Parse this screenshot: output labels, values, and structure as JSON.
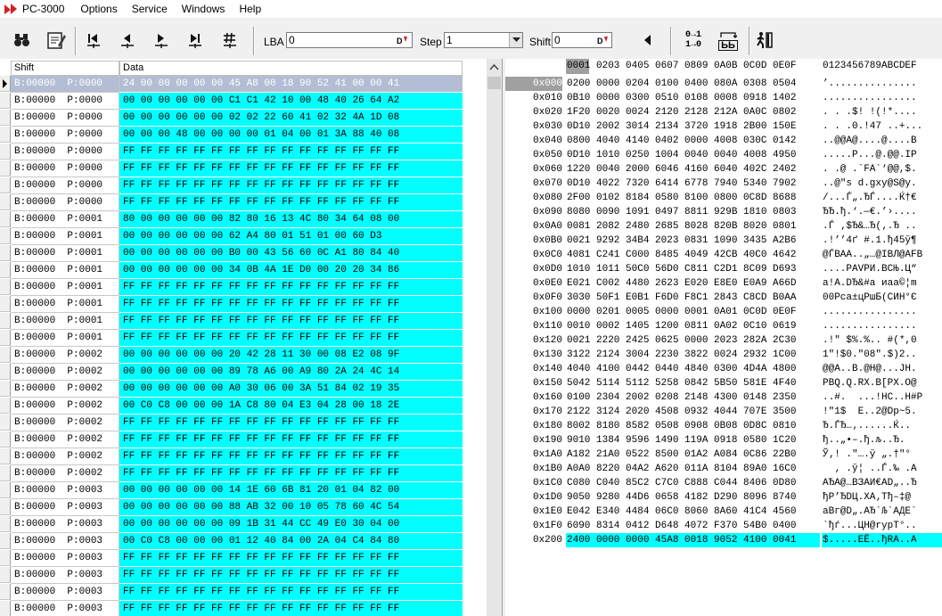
{
  "app": {
    "title": "PC-3000"
  },
  "menu": [
    "Options",
    "Service",
    "Windows",
    "Help"
  ],
  "toolbar": {
    "lba_label": "LBA",
    "lba_value": "0",
    "step_label": "Step",
    "step_value": "1",
    "shift_label": "Shift",
    "shift_value": "0",
    "convert_label_top": "0→1",
    "convert_label_bottom": "1→0",
    "swap_label": "ЬЬ"
  },
  "sectors": {
    "columns": [
      "Shift",
      "Data"
    ],
    "rows": [
      {
        "shift": "B:00000  P:0000",
        "data": "24 00 00 00 00 00 45 A8 00 18 90 52 41 00 00 41"
      },
      {
        "shift": "B:00000  P:0000",
        "data": "00 00 00 00 00 00 C1 C1 42 10 00 48 40 26 64 A2"
      },
      {
        "shift": "B:00000  P:0000",
        "data": "00 00 00 00 00 00 02 02 22 60 41 02 32 4A 1D 08"
      },
      {
        "shift": "B:00000  P:0000",
        "data": "00 00 00 48 00 00 00 00 01 04 00 01 3A 88 40 08"
      },
      {
        "shift": "B:00000  P:0000",
        "data": "FF FF FF FF FF FF FF FF FF FF FF FF FF FF FF FF"
      },
      {
        "shift": "B:00000  P:0000",
        "data": "FF FF FF FF FF FF FF FF FF FF FF FF FF FF FF FF"
      },
      {
        "shift": "B:00000  P:0000",
        "data": "FF FF FF FF FF FF FF FF FF FF FF FF FF FF FF FF"
      },
      {
        "shift": "B:00000  P:0000",
        "data": "FF FF FF FF FF FF FF FF FF FF FF FF FF FF FF FF"
      },
      {
        "shift": "B:00000  P:0001",
        "data": "80 00 00 00 00 00 82 80 16 13 4C 80 34 64 08 00"
      },
      {
        "shift": "B:00000  P:0001",
        "data": "00 00 00 00 00 00 62 A4 80 01 51 01 00 60 D3"
      },
      {
        "shift": "B:00000  P:0001",
        "data": "00 00 00 00 00 00 B0 00 43 56 60 0C A1 80 84 40"
      },
      {
        "shift": "B:00000  P:0001",
        "data": "00 00 00 00 00 00 34 0B 4A 1E D0 00 20 20 34 86"
      },
      {
        "shift": "B:00000  P:0001",
        "data": "FF FF FF FF FF FF FF FF FF FF FF FF FF FF FF FF"
      },
      {
        "shift": "B:00000  P:0001",
        "data": "FF FF FF FF FF FF FF FF FF FF FF FF FF FF FF FF"
      },
      {
        "shift": "B:00000  P:0001",
        "data": "FF FF FF FF FF FF FF FF FF FF FF FF FF FF FF FF"
      },
      {
        "shift": "B:00000  P:0001",
        "data": "FF FF FF FF FF FF FF FF FF FF FF FF FF FF FF FF"
      },
      {
        "shift": "B:00000  P:0002",
        "data": "00 00 00 00 00 00 20 42 28 11 30 00 08 E2 08 9F"
      },
      {
        "shift": "B:00000  P:0002",
        "data": "00 00 00 00 00 00 89 78 A6 00 A9 80 2A 24 4C 14"
      },
      {
        "shift": "B:00000  P:0002",
        "data": "00 00 00 00 00 00 A0 30 06 00 3A 51 84 02 19 35"
      },
      {
        "shift": "B:00000  P:0002",
        "data": "00 C0 C8 00 00 00 1A C8 80 04 E3 04 28 00 18 2E"
      },
      {
        "shift": "B:00000  P:0002",
        "data": "FF FF FF FF FF FF FF FF FF FF FF FF FF FF FF FF"
      },
      {
        "shift": "B:00000  P:0002",
        "data": "FF FF FF FF FF FF FF FF FF FF FF FF FF FF FF FF"
      },
      {
        "shift": "B:00000  P:0002",
        "data": "FF FF FF FF FF FF FF FF FF FF FF FF FF FF FF FF"
      },
      {
        "shift": "B:00000  P:0002",
        "data": "FF FF FF FF FF FF FF FF FF FF FF FF FF FF FF FF"
      },
      {
        "shift": "B:00000  P:0003",
        "data": "00 00 00 00 00 00 14 1E 60 6B 81 20 01 04 82 00"
      },
      {
        "shift": "B:00000  P:0003",
        "data": "00 00 00 00 00 00 88 AB 32 00 10 05 78 60 4C 54"
      },
      {
        "shift": "B:00000  P:0003",
        "data": "00 00 00 00 00 00 09 1B 31 44 CC 49 E0 30 04 00"
      },
      {
        "shift": "B:00000  P:0003",
        "data": "00 C0 C8 00 00 00 01 12 40 84 00 2A 04 C4 84 80"
      },
      {
        "shift": "B:00000  P:0003",
        "data": "FF FF FF FF FF FF FF FF FF FF FF FF FF FF FF FF"
      },
      {
        "shift": "B:00000  P:0003",
        "data": "FF FF FF FF FF FF FF FF FF FF FF FF FF FF FF FF"
      },
      {
        "shift": "B:00000  P:0003",
        "data": "FF FF FF FF FF FF FF FF FF FF FF FF FF FF FF FF"
      },
      {
        "shift": "B:00000  P:0003",
        "data": "FF FF FF FF FF FF FF FF FF FF FF FF FF FF FF FF"
      }
    ]
  },
  "hex": {
    "header_hex": "0001 0203 0405 0607 0809 0A0B 0C0D 0E0F",
    "header_ascii": "0123456789ABCDEF",
    "rows": [
      {
        "off": "0x000",
        "hex": "0200 0000 0204 0100 0400 080A 0308 0504",
        "asc": "’..............."
      },
      {
        "off": "0x010",
        "hex": "0B10 0000 0300 0510 0108 0008 0918 1402",
        "asc": "................"
      },
      {
        "off": "0x020",
        "hex": "1F20 0020 0024 2120 2128 212A 0A0C 0802",
        "asc": ". . .$! !(!*...."
      },
      {
        "off": "0x030",
        "hex": "0D10 2002 3014 2134 3720 1918 2B00 150E",
        "asc": ". . .0.!47 ..+..."
      },
      {
        "off": "0x040",
        "hex": "0800 4040 4140 0402 0000 4008 030C 0142",
        "asc": "..@@A@....@....B"
      },
      {
        "off": "0x050",
        "hex": "0D10 1010 0250 1004 0040 0040 4008 4950",
        "asc": ".....P...@.@@.IP"
      },
      {
        "off": "0x060",
        "hex": "1220 0040 2000 6046 4160 6040 402C 2402",
        "asc": ". .@ .`FA`‘@@,$."
      },
      {
        "off": "0x070",
        "hex": "0D10 4022 7320 6414 6778 7940 5340 7902",
        "asc": "..@\"s d.gxy@S@y."
      },
      {
        "off": "0x080",
        "hex": "2F00 0102 8184 0580 8100 0800 0C8D 8688",
        "asc": "/...Ѓ„.ЂЃ....Ќ†€"
      },
      {
        "off": "0x090",
        "hex": "8080 0090 1091 0497 8811 929B 1810 0803",
        "asc": "ЂЂ.ђ.‘.—€.’›...."
      },
      {
        "off": "0x0A0",
        "hex": "0081 2082 2480 2685 8028 820B 8020 0801",
        "asc": ".Ѓ ‚$Ђ&…Ђ(‚.Ђ .."
      },
      {
        "off": "0x0B0",
        "hex": "0021 9292 34B4 2023 0831 1090 3435 A2B6",
        "asc": ".!’’4ґ #.1.ђ45ў¶"
      },
      {
        "off": "0x0C0",
        "hex": "4081 C241 C000 8485 4049 42CB 40C0 4642",
        "asc": "@ЃВAА..„…@IВЛ@АFB"
      },
      {
        "off": "0x0D0",
        "hex": "1010 1011 50C0 56D0 C811 C2D1 8C09 D693",
        "asc": "....PАVРИ.ВСЊ.Ц“"
      },
      {
        "off": "0x0E0",
        "hex": "E021 C002 4480 2623 E020 E8E0 E0A9 A66D",
        "asc": "а!А.DЂ&#а иаа©¦m"
      },
      {
        "off": "0x0F0",
        "hex": "3030 50F1 E0B1 F6D0 F8C1 2843 C8CD B0AA",
        "asc": "00Pсa±цРшБ(СИН°Є"
      },
      {
        "off": "0x100",
        "hex": "0000 0201 0005 0000 0001 0A01 0C0D 0E0F",
        "asc": "................"
      },
      {
        "off": "0x110",
        "hex": "0010 0002 1405 1200 0811 0A02 0C10 0619",
        "asc": "................"
      },
      {
        "off": "0x120",
        "hex": "0021 2220 2425 0625 0000 2023 282A 2C30",
        "asc": ".!\" $%.%.. #(*,0"
      },
      {
        "off": "0x130",
        "hex": "3122 2124 3004 2230 3822 0024 2932 1C00",
        "asc": "1\"!$0.\"08\".$)2.."
      },
      {
        "off": "0x140",
        "hex": "4040 4100 0442 0440 4840 0300 4D4A 4800",
        "asc": "@@A..B.@H@...JH."
      },
      {
        "off": "0x150",
        "hex": "5042 5114 5112 5258 0842 5B50 581E 4F40",
        "asc": "PBQ.Q.RX.B[PX.O@"
      },
      {
        "off": "0x160",
        "hex": "0100 2304 2002 0208 2148 4300 0148 2350",
        "asc": "..#.  ...!HC..H#P"
      },
      {
        "off": "0x170",
        "hex": "2122 3124 2020 4508 0932 4044 707E 3500",
        "asc": "!\"1$  E..2@Dp~5."
      },
      {
        "off": "0x180",
        "hex": "8002 8180 8582 0508 0908 0B08 0D8C 0810",
        "asc": "Ђ.ЃЂ…‚......Ќ.."
      },
      {
        "off": "0x190",
        "hex": "9010 1384 9596 1490 119A 0918 0580 1C20",
        "asc": "ђ..„•–.ђ.љ..Ђ. "
      },
      {
        "off": "0x1A0",
        "hex": "A182 21A0 0522 8500 01A2 A084 0C86 22B0",
        "asc": "Ў‚! .\"….ў „.†\"°"
      },
      {
        "off": "0x1B0",
        "hex": "A0A0 8220 04A2 A620 011A 8104 89A0 16C0",
        "asc": "  ‚ .ў¦ ..Ѓ.‰ .А"
      },
      {
        "off": "0x1C0",
        "hex": "C080 C040 85C2 C7C0 C888 C044 8406 0D80",
        "asc": "АЂА@…ВЗАИ€АD„..Ђ"
      },
      {
        "off": "0x1D0",
        "hex": "9050 9280 44D6 0658 4182 D290 8096 8740",
        "asc": "ђP’ЂDЦ.XA‚Тђ–‡@"
      },
      {
        "off": "0x1E0",
        "hex": "E042 E340 4484 06C0 8060 8A60 41C4 4560",
        "asc": "аBг@D„.АЂ`Љ`AДE`"
      },
      {
        "off": "0x1F0",
        "hex": "6090 8314 0412 D648 4072 F370 54B0 0400",
        "asc": "`ђѓ...ЦH@rуpT°.."
      },
      {
        "off": "0x200",
        "hex": "2400 0000 0000 45A8 0018 9052 4100 0041",
        "asc": "$.....EЁ..ђRA..A"
      }
    ]
  }
}
